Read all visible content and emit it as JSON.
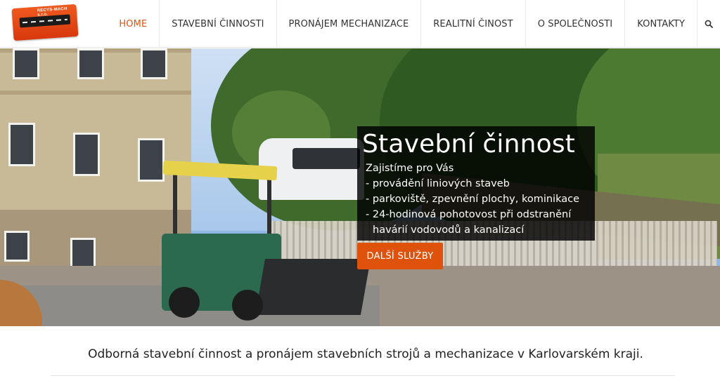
{
  "logo": {
    "text": "RECYS-MACH s.r.o."
  },
  "nav": {
    "items": [
      {
        "label": "HOME",
        "active": true
      },
      {
        "label": "STAVEBNÍ ČINNOSTI",
        "active": false
      },
      {
        "label": "PRONÁJEM MECHANIZACE",
        "active": false
      },
      {
        "label": "REALITNÍ ČINOST",
        "active": false
      },
      {
        "label": "O SPOLEČNOSTI",
        "active": false
      },
      {
        "label": "KONTAKTY",
        "active": false
      }
    ],
    "search_icon": "search-icon"
  },
  "hero": {
    "title": "Stavební činnost",
    "lines": [
      "Zajistíme pro Vás",
      "- provádění liniových staveb",
      "- parkoviště, zpevnění plochy, kominikace",
      "- 24-hodinová pohotovost při odstranění",
      "havárií vodovodů a kanalizací"
    ],
    "cta_label": "DALŠÍ SLUŽBY"
  },
  "tagline": "Odborná stavební činnost a pronájem stavebních strojů a mechanizace v Karlovarském kraji.",
  "colors": {
    "accent": "#df520c",
    "overlay": "#000000"
  }
}
